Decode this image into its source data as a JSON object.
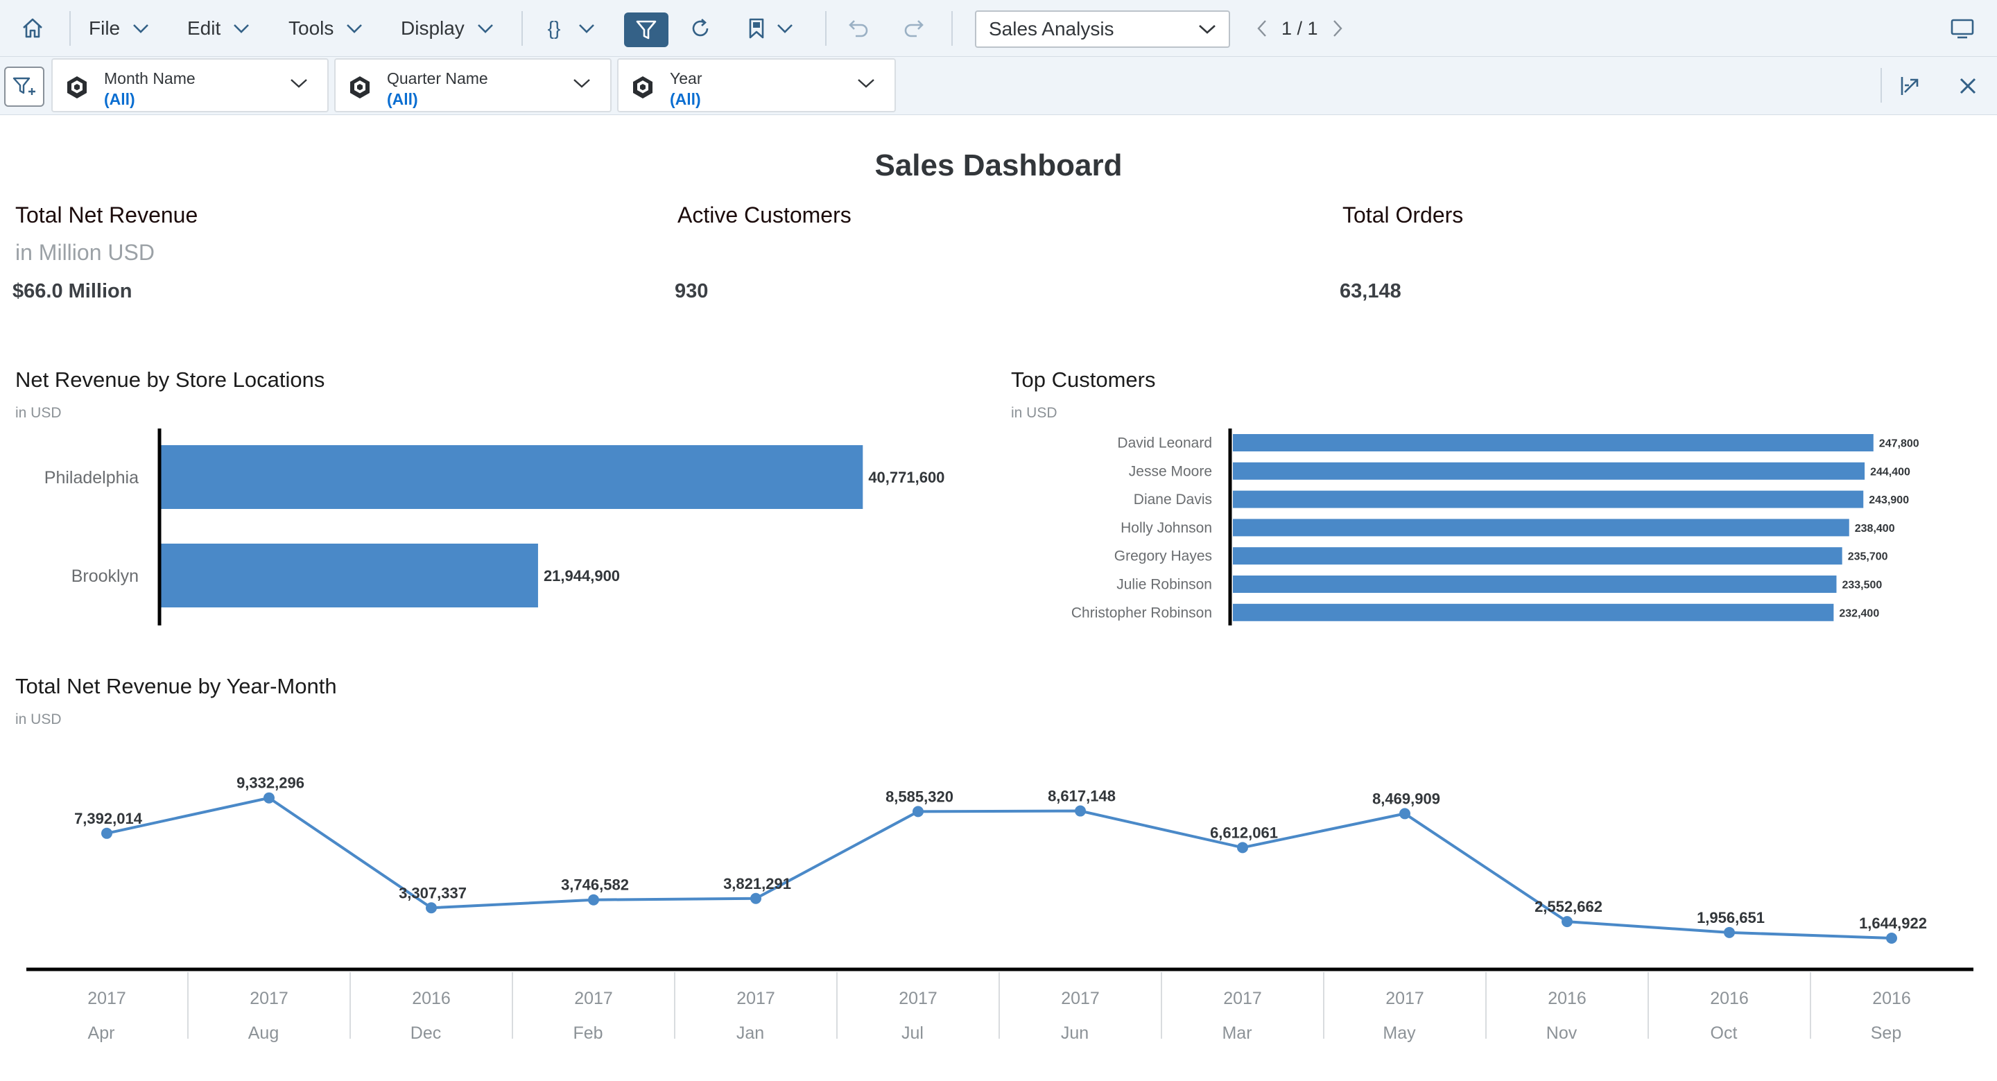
{
  "toolbar": {
    "file_label": "File",
    "edit_label": "Edit",
    "tools_label": "Tools",
    "display_label": "Display",
    "story_name": "Sales Analysis",
    "page_indicator": "1 / 1"
  },
  "filters": [
    {
      "name": "Month Name",
      "value": "(All)"
    },
    {
      "name": "Quarter Name",
      "value": "(All)"
    },
    {
      "name": "Year",
      "value": "(All)"
    }
  ],
  "dashboard": {
    "title": "Sales Dashboard",
    "kpis": [
      {
        "title": "Total Net Revenue",
        "subtitle": "in Million USD",
        "value": "$66.0 Million"
      },
      {
        "title": "Active Customers",
        "subtitle": "",
        "value": "930"
      },
      {
        "title": "Total Orders",
        "subtitle": "",
        "value": "63,148"
      }
    ]
  },
  "chart_data": [
    {
      "type": "bar",
      "orientation": "horizontal",
      "title": "Net Revenue by Store Locations",
      "subtitle": "in USD",
      "categories": [
        "Philadelphia",
        "Brooklyn"
      ],
      "values": [
        40771600,
        21944900
      ],
      "value_labels": [
        "40,771,600",
        "21,944,900"
      ],
      "color": "#4a89c8"
    },
    {
      "type": "bar",
      "orientation": "horizontal",
      "title": "Top Customers",
      "subtitle": "in USD",
      "categories": [
        "David Leonard",
        "Jesse Moore",
        "Diane Davis",
        "Holly Johnson",
        "Gregory Hayes",
        "Julie Robinson",
        "Christopher Robinson"
      ],
      "values": [
        247800,
        244400,
        243900,
        238400,
        235700,
        233500,
        232400
      ],
      "value_labels": [
        "247,800",
        "244,400",
        "243,900",
        "238,400",
        "235,700",
        "233,500",
        "232,400"
      ],
      "color": "#4a89c8"
    },
    {
      "type": "line",
      "title": "Total Net Revenue by Year-Month",
      "subtitle": "in USD",
      "categories": [
        {
          "year": "2017",
          "month": "Apr"
        },
        {
          "year": "2017",
          "month": "Aug"
        },
        {
          "year": "2016",
          "month": "Dec"
        },
        {
          "year": "2017",
          "month": "Feb"
        },
        {
          "year": "2017",
          "month": "Jan"
        },
        {
          "year": "2017",
          "month": "Jul"
        },
        {
          "year": "2017",
          "month": "Jun"
        },
        {
          "year": "2017",
          "month": "Mar"
        },
        {
          "year": "2017",
          "month": "May"
        },
        {
          "year": "2016",
          "month": "Nov"
        },
        {
          "year": "2016",
          "month": "Oct"
        },
        {
          "year": "2016",
          "month": "Sep"
        }
      ],
      "values": [
        7392014,
        9332296,
        3307337,
        3746582,
        3821291,
        8585320,
        8617148,
        6612061,
        8469909,
        2552662,
        1956651,
        1644922
      ],
      "value_labels": [
        "7,392,014",
        "9,332,296",
        "3,307,337",
        "3,746,582",
        "3,821,291",
        "8,585,320",
        "8,617,148",
        "6,612,061",
        "8,469,909",
        "2,552,662",
        "1,956,651",
        "1,644,922"
      ],
      "color": "#4a89c8"
    }
  ]
}
